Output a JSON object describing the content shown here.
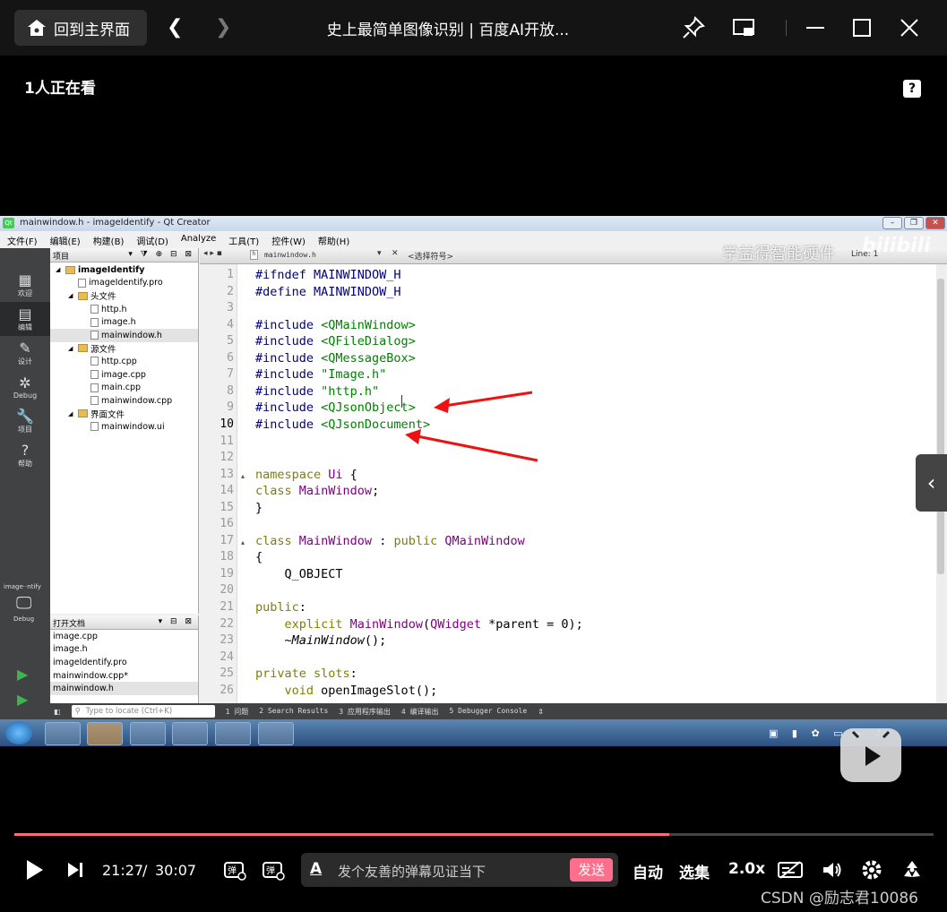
{
  "topbar": {
    "home_label": "回到主界面",
    "title": "史上最简单图像识别 | 百度AI开放..."
  },
  "viewer_count": "1人正在看",
  "qt": {
    "window_title": "mainwindow.h - imageIdentify - Qt Creator",
    "menu": [
      "文件(F)",
      "编辑(E)",
      "构建(B)",
      "调试(D)",
      "Analyze",
      "工具(T)",
      "控件(W)",
      "帮助(H)"
    ],
    "modes": [
      {
        "glyph": "▦",
        "label": "欢迎"
      },
      {
        "glyph": "▤",
        "label": "编辑"
      },
      {
        "glyph": "✎",
        "label": "设计"
      },
      {
        "glyph": "✲",
        "label": "Debug"
      },
      {
        "glyph": "🔧",
        "label": "项目"
      },
      {
        "glyph": "?",
        "label": "帮助"
      }
    ],
    "kit_label": "image··ntify",
    "kit_mode": "Debug",
    "project_panel_title": "项目",
    "project_tree": [
      {
        "indent": 0,
        "kind": "project",
        "label": "imageIdentify"
      },
      {
        "indent": 1,
        "kind": "file",
        "label": "imageIdentify.pro"
      },
      {
        "indent": 1,
        "kind": "folder",
        "label": "头文件"
      },
      {
        "indent": 2,
        "kind": "file",
        "label": "http.h"
      },
      {
        "indent": 2,
        "kind": "file",
        "label": "image.h"
      },
      {
        "indent": 2,
        "kind": "file",
        "label": "mainwindow.h"
      },
      {
        "indent": 1,
        "kind": "folder",
        "label": "源文件"
      },
      {
        "indent": 2,
        "kind": "file",
        "label": "http.cpp"
      },
      {
        "indent": 2,
        "kind": "file",
        "label": "image.cpp"
      },
      {
        "indent": 2,
        "kind": "file",
        "label": "main.cpp"
      },
      {
        "indent": 2,
        "kind": "file",
        "label": "mainwindow.cpp"
      },
      {
        "indent": 1,
        "kind": "folder",
        "label": "界面文件"
      },
      {
        "indent": 2,
        "kind": "file",
        "label": "mainwindow.ui"
      }
    ],
    "open_docs_title": "打开文档",
    "open_docs": [
      "image.cpp",
      "image.h",
      "imageIdentify.pro",
      "mainwindow.cpp*",
      "mainwindow.h"
    ],
    "editor_file": "mainwindow.h",
    "symbol_select": "<选择符号>",
    "line_col": "Line: 1",
    "code_lines": [
      {
        "n": "1",
        "code": [
          [
            "pp",
            "#ifndef MAINWINDOW_H"
          ]
        ]
      },
      {
        "n": "2",
        "code": [
          [
            "pp",
            "#define MAINWINDOW_H"
          ]
        ]
      },
      {
        "n": "3",
        "code": []
      },
      {
        "n": "4",
        "code": [
          [
            "pp",
            "#include "
          ],
          [
            "str",
            "<QMainWindow>"
          ]
        ]
      },
      {
        "n": "5",
        "code": [
          [
            "pp",
            "#include "
          ],
          [
            "str",
            "<QFileDialog>"
          ]
        ]
      },
      {
        "n": "6",
        "code": [
          [
            "pp",
            "#include "
          ],
          [
            "str",
            "<QMessageBox>"
          ]
        ]
      },
      {
        "n": "7",
        "code": [
          [
            "pp",
            "#include "
          ],
          [
            "str",
            "\"Image.h\""
          ]
        ]
      },
      {
        "n": "8",
        "code": [
          [
            "pp",
            "#include "
          ],
          [
            "str",
            "\"http.h\""
          ]
        ]
      },
      {
        "n": "9",
        "code": [
          [
            "pp",
            "#include "
          ],
          [
            "str",
            "<QJsonObject>"
          ]
        ]
      },
      {
        "n": "10",
        "code": [
          [
            "pp",
            "#include "
          ],
          [
            "str",
            "<QJsonDocument>"
          ]
        ]
      },
      {
        "n": "11",
        "code": []
      },
      {
        "n": "12",
        "code": []
      },
      {
        "n": "13",
        "code": [
          [
            "kw",
            "namespace "
          ],
          [
            "ty",
            "Ui "
          ],
          [
            "",
            "{"
          ]
        ]
      },
      {
        "n": "14",
        "code": [
          [
            "kw",
            "class "
          ],
          [
            "ty",
            "MainWindow"
          ],
          [
            "",
            ";"
          ]
        ]
      },
      {
        "n": "15",
        "code": [
          [
            "",
            "}"
          ]
        ]
      },
      {
        "n": "16",
        "code": []
      },
      {
        "n": "17",
        "code": [
          [
            "kw",
            "class "
          ],
          [
            "ty",
            "MainWindow"
          ],
          [
            "",
            " : "
          ],
          [
            "kw",
            "public "
          ],
          [
            "ty",
            "QMainWindow"
          ]
        ]
      },
      {
        "n": "18",
        "code": [
          [
            "",
            "{"
          ]
        ]
      },
      {
        "n": "19",
        "code": [
          [
            "",
            "    Q_OBJECT"
          ]
        ]
      },
      {
        "n": "20",
        "code": []
      },
      {
        "n": "21",
        "code": [
          [
            "kw",
            "public"
          ],
          [
            "",
            ":"
          ]
        ]
      },
      {
        "n": "22",
        "code": [
          [
            "",
            "    "
          ],
          [
            "kw",
            "explicit "
          ],
          [
            "ty",
            "MainWindow"
          ],
          [
            "",
            "("
          ],
          [
            "ty",
            "QWidget"
          ],
          [
            "",
            " *parent = 0);"
          ]
        ]
      },
      {
        "n": "23",
        "code": [
          [
            "",
            "    "
          ],
          [
            "it",
            "~MainWindow"
          ],
          [
            "",
            "();"
          ]
        ]
      },
      {
        "n": "24",
        "code": []
      },
      {
        "n": "25",
        "code": [
          [
            "kw",
            "private slots"
          ],
          [
            "",
            ":"
          ]
        ]
      },
      {
        "n": "26",
        "code": [
          [
            "",
            "    "
          ],
          [
            "kw",
            "void "
          ],
          [
            "",
            "openImageSlot();"
          ]
        ]
      }
    ],
    "locate_placeholder": "Type to locate (Ctrl+K)",
    "output_tabs": [
      "1 问题",
      "2 Search Results",
      "3 应用程序输出",
      "4 编译输出",
      "5 Debugger Console"
    ]
  },
  "watermark": "学益得智能硬件",
  "bili_logo": "bilibili",
  "player": {
    "progress": 0.712,
    "current_time": "21:27",
    "separator": "/",
    "total_time": "30:07",
    "danmu_placeholder": "发个友善的弹幕见证当下",
    "send_label": "发送",
    "auto_label": "自动",
    "episodes_label": "选集",
    "speed_label": "2.0x"
  },
  "credit": "CSDN @励志君10086",
  "colors": {
    "progress_fill": "#ff6b7b",
    "send_button": "#ff6f8c",
    "annotation_arrow": "#ee1111"
  }
}
